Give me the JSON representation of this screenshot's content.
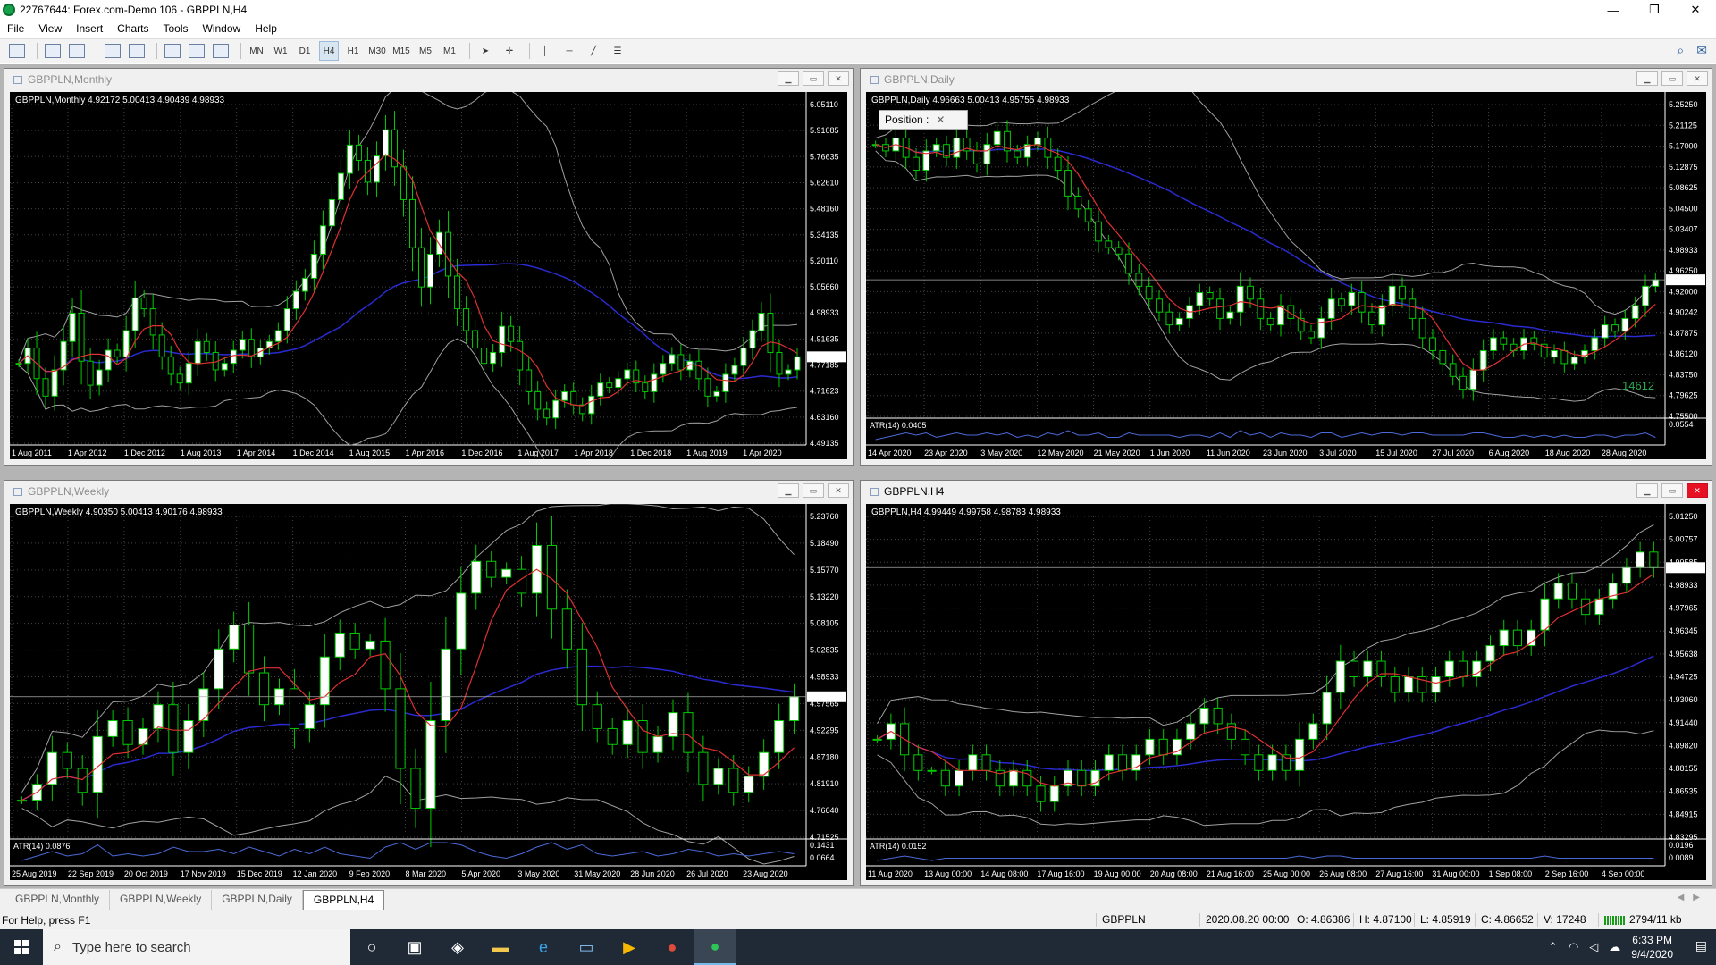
{
  "window": {
    "title": "22767644: Forex.com-Demo 106 - GBPPLN,H4",
    "minimize": "—",
    "restore": "❐",
    "close": "✕"
  },
  "menu": [
    "File",
    "View",
    "Insert",
    "Charts",
    "Tools",
    "Window",
    "Help"
  ],
  "toolbar": {
    "timeframes": [
      "MN",
      "W1",
      "D1",
      "H4",
      "H1",
      "M30",
      "M15",
      "M5",
      "M1"
    ],
    "active_timeframe": "H4"
  },
  "charts": [
    {
      "id": "monthly",
      "title": "GBPPLN,Monthly",
      "legend": "GBPPLN,Monthly  4.92172 5.00413 4.90439 4.98933",
      "price_labels": [
        "6.05110",
        "5.91085",
        "5.76635",
        "5.62610",
        "5.48160",
        "5.34135",
        "5.20110",
        "5.05660",
        "4.98933",
        "4.91635",
        "4.77185",
        "4.71623",
        "4.63160",
        "4.49135"
      ],
      "time_labels": [
        "1 Aug 2011",
        "1 Apr 2012",
        "1 Dec 2012",
        "1 Aug 2013",
        "1 Apr 2014",
        "1 Dec 2014",
        "1 Aug 2015",
        "1 Apr 2016",
        "1 Dec 2016",
        "1 Aug 2017",
        "1 Apr 2018",
        "1 Dec 2018",
        "1 Aug 2019",
        "1 Apr 2020"
      ],
      "atr": null,
      "atr_scale": [],
      "active": false,
      "series": [
        4.95,
        5.02,
        4.88,
        4.8,
        4.92,
        5.05,
        5.18,
        4.96,
        4.85,
        4.92,
        5.01,
        4.98,
        5.1,
        5.25,
        5.2,
        5.08,
        4.98,
        4.9,
        4.86,
        4.95,
        5.05,
        5.0,
        4.92,
        4.95,
        5.01,
        5.06,
        4.98,
        5.02,
        5.05,
        5.1,
        5.2,
        5.28,
        5.34,
        5.45,
        5.58,
        5.7,
        5.82,
        5.95,
        5.88,
        5.78,
        5.9,
        6.02,
        5.85,
        5.7,
        5.48,
        5.3,
        5.45,
        5.55,
        5.35,
        5.2,
        5.1,
        5.02,
        4.95,
        5.0,
        5.12,
        5.05,
        4.92,
        4.82,
        4.74,
        4.7,
        4.78,
        4.82,
        4.76,
        4.72,
        4.8,
        4.86,
        4.84,
        4.88,
        4.92,
        4.86,
        4.82,
        4.9,
        4.95,
        4.99,
        4.92,
        4.96,
        4.88,
        4.8,
        4.82,
        4.9,
        4.94,
        5.02,
        5.1,
        5.18,
        5.0,
        4.9,
        4.92,
        4.98
      ]
    },
    {
      "id": "daily",
      "title": "GBPPLN,Daily",
      "legend": "GBPPLN,Daily  4.96663 5.00413 4.95755 4.98933",
      "price_labels": [
        "5.25250",
        "5.21125",
        "5.17000",
        "5.12875",
        "5.08625",
        "5.04500",
        "5.03407",
        "4.98933",
        "4.96250",
        "4.92000",
        "4.90242",
        "4.87875",
        "4.86120",
        "4.83750",
        "4.79625",
        "4.75500"
      ],
      "time_labels": [
        "14 Apr 2020",
        "23 Apr 2020",
        "3 May 2020",
        "12 May 2020",
        "21 May 2020",
        "1 Jun 2020",
        "11 Jun 2020",
        "23 Jun 2020",
        "3 Jul 2020",
        "15 Jul 2020",
        "27 Jul 2020",
        "6 Aug 2020",
        "18 Aug 2020",
        "28 Aug 2020"
      ],
      "atr": "ATR(14) 0.0405",
      "atr_scale": [
        "0.0554"
      ],
      "watermark": "14612",
      "position_panel": "Position :",
      "active": false,
      "series": [
        5.2,
        5.19,
        5.21,
        5.18,
        5.16,
        5.19,
        5.2,
        5.18,
        5.21,
        5.19,
        5.17,
        5.2,
        5.22,
        5.19,
        5.18,
        5.2,
        5.21,
        5.18,
        5.16,
        5.12,
        5.1,
        5.08,
        5.05,
        5.04,
        5.03,
        5.0,
        4.98,
        4.96,
        4.94,
        4.92,
        4.93,
        4.95,
        4.97,
        4.96,
        4.93,
        4.94,
        4.98,
        4.96,
        4.93,
        4.92,
        4.95,
        4.93,
        4.91,
        4.9,
        4.93,
        4.96,
        4.95,
        4.97,
        4.94,
        4.92,
        4.95,
        4.98,
        4.96,
        4.93,
        4.9,
        4.88,
        4.86,
        4.84,
        4.82,
        4.85,
        4.88,
        4.9,
        4.89,
        4.88,
        4.9,
        4.89,
        4.87,
        4.88,
        4.86,
        4.87,
        4.88,
        4.9,
        4.92,
        4.91,
        4.93,
        4.95,
        4.98,
        4.99
      ]
    },
    {
      "id": "weekly",
      "title": "GBPPLN,Weekly",
      "legend": "GBPPLN,Weekly  4.90350 5.00413 4.90176 4.98933",
      "price_labels": [
        "5.23760",
        "5.18490",
        "5.15770",
        "5.13220",
        "5.08105",
        "5.02835",
        "4.98933",
        "4.97565",
        "4.92295",
        "4.87180",
        "4.81910",
        "4.76640",
        "4.71525"
      ],
      "time_labels": [
        "25 Aug 2019",
        "22 Sep 2019",
        "20 Oct 2019",
        "17 Nov 2019",
        "15 Dec 2019",
        "12 Jan 2020",
        "9 Feb 2020",
        "8 Mar 2020",
        "5 Apr 2020",
        "3 May 2020",
        "31 May 2020",
        "28 Jun 2020",
        "26 Jul 2020",
        "23 Aug 2020"
      ],
      "atr": "ATR(14) 0.0876",
      "atr_scale": [
        "0.1431",
        "0.0664"
      ],
      "active": false,
      "series": [
        4.86,
        4.88,
        4.92,
        4.9,
        4.87,
        4.94,
        4.96,
        4.93,
        4.95,
        4.98,
        4.92,
        4.96,
        5.0,
        5.05,
        5.08,
        5.02,
        4.98,
        5.0,
        4.95,
        4.98,
        5.04,
        5.07,
        5.05,
        5.06,
        5.0,
        4.9,
        4.85,
        4.96,
        5.05,
        5.12,
        5.16,
        5.14,
        5.15,
        5.12,
        5.18,
        5.1,
        5.05,
        4.98,
        4.95,
        4.93,
        4.96,
        4.92,
        4.94,
        4.97,
        4.92,
        4.88,
        4.9,
        4.87,
        4.89,
        4.92,
        4.96,
        4.99
      ]
    },
    {
      "id": "h4",
      "title": "GBPPLN,H4",
      "legend": "GBPPLN,H4  4.99449 4.99758 4.98783 4.98933",
      "price_labels": [
        "5.01250",
        "5.00757",
        "4.99585",
        "4.98933",
        "4.97965",
        "4.96345",
        "4.95638",
        "4.94725",
        "4.93060",
        "4.91440",
        "4.89820",
        "4.88155",
        "4.86535",
        "4.84915",
        "4.83295"
      ],
      "time_labels": [
        "11 Aug 2020",
        "13 Aug 00:00",
        "14 Aug 08:00",
        "17 Aug 16:00",
        "19 Aug 00:00",
        "20 Aug 08:00",
        "21 Aug 16:00",
        "25 Aug 00:00",
        "26 Aug 08:00",
        "27 Aug 16:00",
        "31 Aug 00:00",
        "1 Sep 08:00",
        "2 Sep 16:00",
        "4 Sep 00:00"
      ],
      "atr": "ATR(14) 0.0152",
      "atr_scale": [
        "0.0196",
        "0.0089"
      ],
      "active": true,
      "series": [
        4.88,
        4.89,
        4.87,
        4.86,
        4.86,
        4.85,
        4.86,
        4.87,
        4.86,
        4.85,
        4.86,
        4.85,
        4.84,
        4.85,
        4.86,
        4.85,
        4.86,
        4.87,
        4.86,
        4.87,
        4.88,
        4.87,
        4.88,
        4.89,
        4.9,
        4.89,
        4.88,
        4.87,
        4.86,
        4.87,
        4.86,
        4.88,
        4.89,
        4.91,
        4.93,
        4.92,
        4.93,
        4.92,
        4.91,
        4.92,
        4.91,
        4.92,
        4.93,
        4.92,
        4.93,
        4.94,
        4.95,
        4.94,
        4.95,
        4.97,
        4.98,
        4.97,
        4.96,
        4.97,
        4.98,
        4.99,
        5.0,
        4.99
      ]
    }
  ],
  "tabs": [
    "GBPPLN,Monthly",
    "GBPPLN,Weekly",
    "GBPPLN,Daily",
    "GBPPLN,H4"
  ],
  "active_tab": "GBPPLN,H4",
  "status": {
    "help": "For Help, press F1",
    "symbol": "GBPPLN",
    "datetime": "2020.08.20 00:00",
    "open": "O: 4.86386",
    "high": "H: 4.87100",
    "low": "L: 4.85919",
    "close": "C: 4.86652",
    "volume": "V: 17248",
    "traffic": "2794/11 kb"
  },
  "taskbar": {
    "search_placeholder": "Type here to search",
    "time": "6:33 PM",
    "date": "9/4/2020"
  },
  "colors": {
    "bull": "#ffffff",
    "bear": "#000000",
    "wick": "#00cc00",
    "ma_fast": "#e03030",
    "ma_slow": "#2a2ad0",
    "band": "#a0a0a0",
    "grid": "#444444",
    "level": "#ffffff"
  }
}
